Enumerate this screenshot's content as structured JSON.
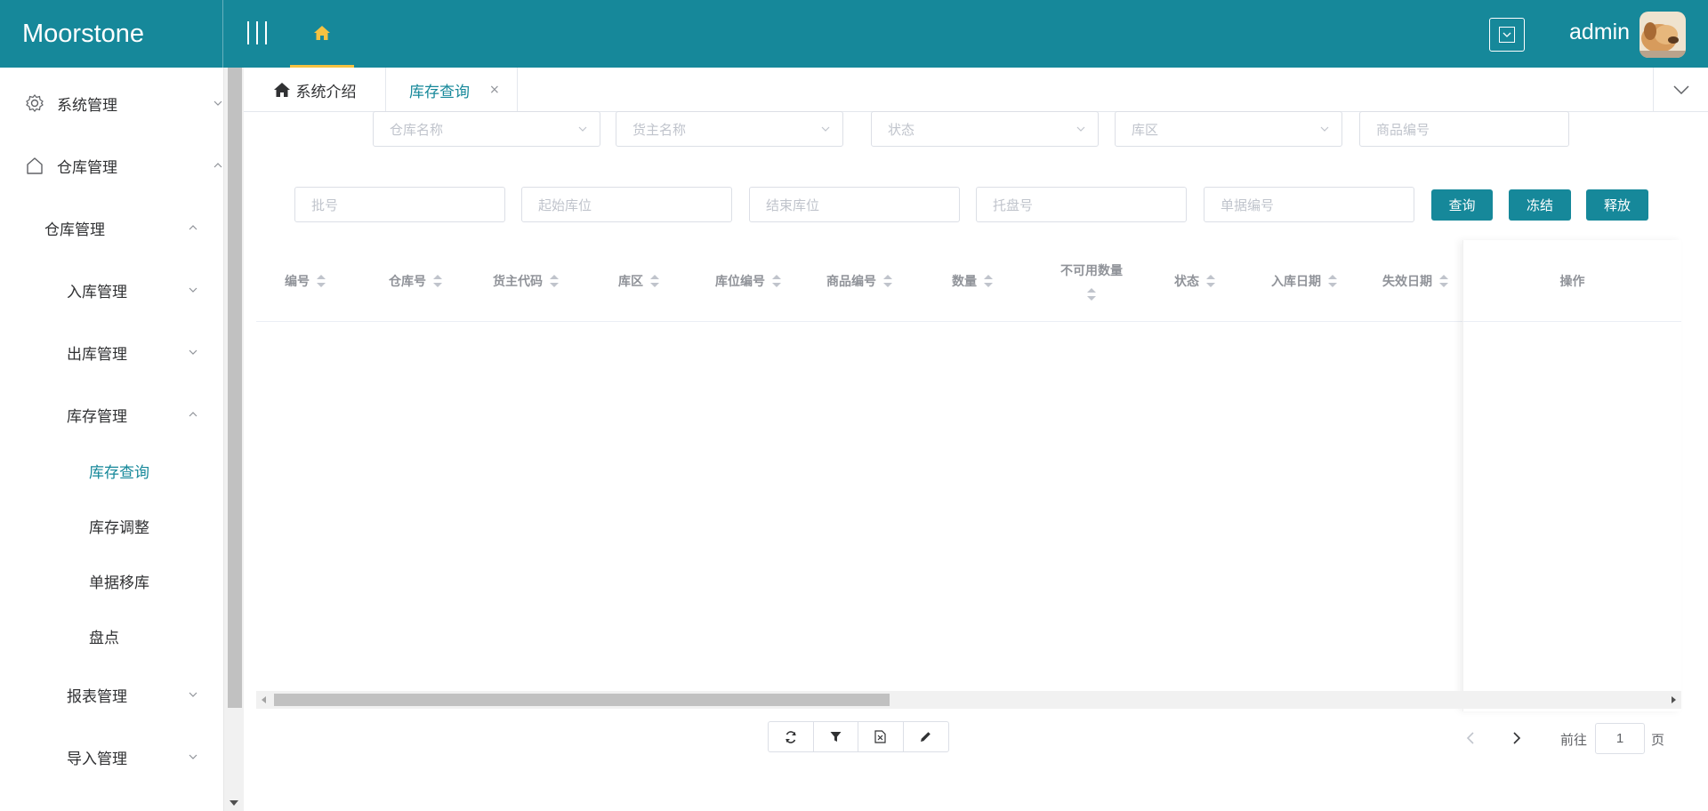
{
  "header": {
    "logo": "Moorstone",
    "username": "admin"
  },
  "sidebar": {
    "items": [
      {
        "label": "系统管理",
        "icon": "gear-icon",
        "expanded": false
      },
      {
        "label": "仓库管理",
        "icon": "home-outline-icon",
        "expanded": true
      },
      {
        "label": "仓库管理",
        "expanded": true
      },
      {
        "label": "入库管理",
        "expanded": false
      },
      {
        "label": "出库管理",
        "expanded": false
      },
      {
        "label": "库存管理",
        "expanded": true
      },
      {
        "label": "库存查询",
        "active": true
      },
      {
        "label": "库存调整"
      },
      {
        "label": "单据移库"
      },
      {
        "label": "盘点"
      },
      {
        "label": "报表管理",
        "expanded": false
      },
      {
        "label": "导入管理",
        "expanded": false
      }
    ]
  },
  "tabs": [
    {
      "label": "系统介绍",
      "icon": "home-icon"
    },
    {
      "label": "库存查询",
      "active": true,
      "closable": true,
      "close_glyph": "×"
    }
  ],
  "filters": {
    "row1": [
      {
        "placeholder": "仓库名称",
        "type": "select"
      },
      {
        "placeholder": "货主名称",
        "type": "select"
      },
      {
        "placeholder": "状态",
        "type": "select"
      },
      {
        "placeholder": "库区",
        "type": "select"
      },
      {
        "placeholder": "商品编号",
        "type": "input"
      }
    ],
    "row2": [
      {
        "placeholder": "批号"
      },
      {
        "placeholder": "起始库位"
      },
      {
        "placeholder": "结束库位"
      },
      {
        "placeholder": "托盘号"
      },
      {
        "placeholder": "单据编号"
      }
    ],
    "buttons": {
      "query": "查询",
      "freeze": "冻结",
      "release": "释放"
    }
  },
  "table": {
    "columns": [
      "编号",
      "仓库号",
      "货主代码",
      "库区",
      "库位编号",
      "商品编号",
      "数量",
      "不可用数量",
      "状态",
      "入库日期",
      "失效日期"
    ],
    "action_column": "操作",
    "rows": []
  },
  "toolbar": [
    "refresh-icon",
    "filter-icon",
    "export-excel-icon",
    "edit-icon"
  ],
  "pagination": {
    "goto_label": "前往",
    "current_page": "1",
    "page_suffix": "页"
  },
  "colors": {
    "primary": "#16889a",
    "accent": "#f5c242"
  }
}
